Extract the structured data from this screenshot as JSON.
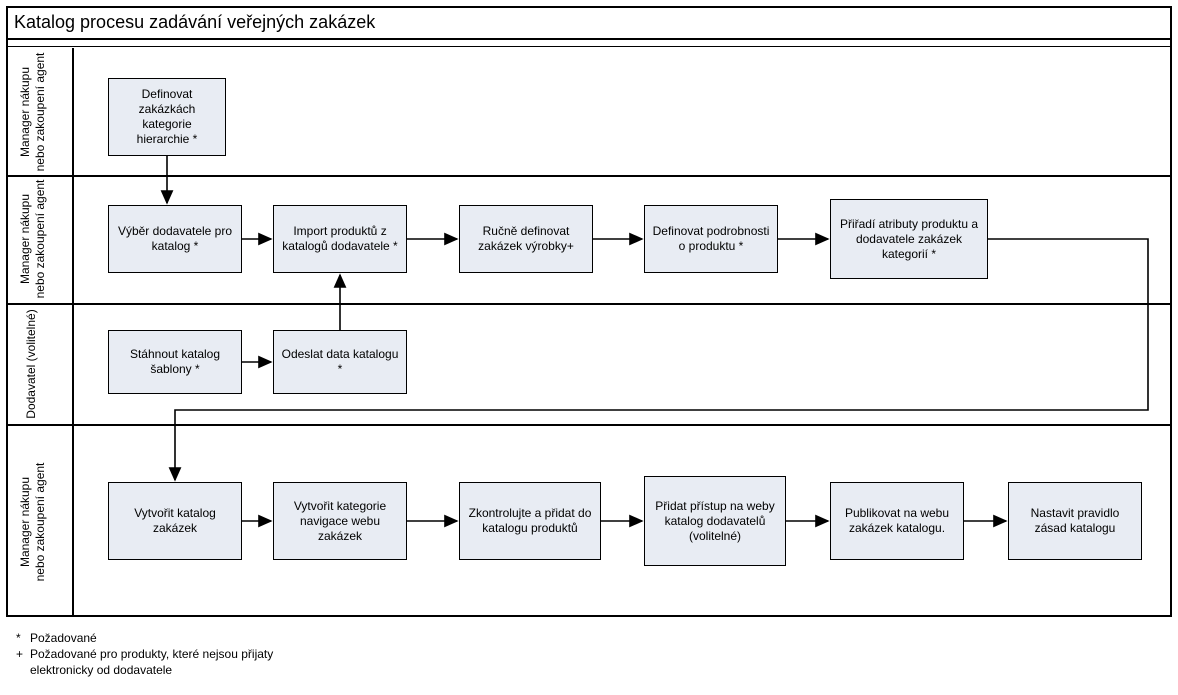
{
  "title": "Katalog procesu zadávání veřejných zakázek",
  "lanes": {
    "l1": "Manager nákupu nebo zakoupení agent",
    "l2": "Manager nákupu nebo zakoupení agent",
    "l3": "Dodavatel (volitelné)",
    "l4": "Manager nákupu nebo zakoupení agent"
  },
  "boxes": {
    "b1": "Definovat zakázkách kategorie hierarchie *",
    "b2": "Výběr dodavatele pro katalog *",
    "b3": "Import produktů z katalogů dodavatele *",
    "b4": "Ručně definovat zakázek výrobky+",
    "b5": "Definovat podrobnosti o produktu *",
    "b6": "Přiřadí atributy produktu a dodavatele zakázek kategorií *",
    "b7": "Stáhnout katalog šablony *",
    "b8": "Odeslat data katalogu *",
    "b9": "Vytvořit katalog zakázek",
    "b10": "Vytvořit kategorie navigace webu zakázek",
    "b11": "Zkontrolujte a přidat do katalogu produktů",
    "b12": "Přidat přístup na weby katalog dodavatelů (volitelné)",
    "b13": "Publikovat na webu zakázek katalogu.",
    "b14": "Nastavit pravidlo zásad katalogu"
  },
  "legend": {
    "req_sym": "*",
    "req_txt": "Požadované",
    "plus_sym": "+",
    "plus_txt": "Požadované pro produkty, které nejsou přijaty elektronicky od dodavatele"
  }
}
